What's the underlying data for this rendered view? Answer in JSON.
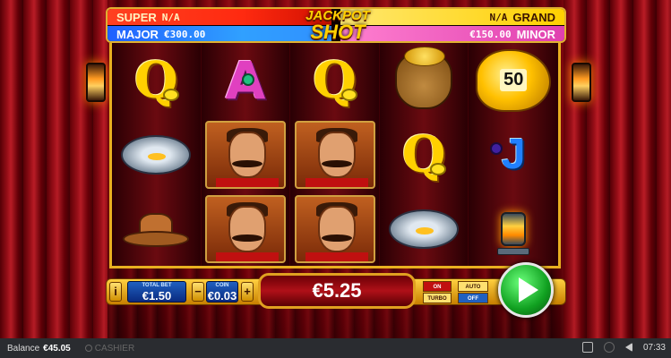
{
  "jackpots": {
    "super_label": "SUPER",
    "super_value": "N/A",
    "grand_label": "GRAND",
    "grand_value": "N/A",
    "major_label": "MAJOR",
    "major_value": "€300.00",
    "minor_label": "MINOR",
    "minor_value": "€150.00",
    "logo_line1": "JACKPOT",
    "logo_line2": "SHOT"
  },
  "reels": [
    [
      "Q-lemon",
      "plate-gold",
      "cowboy-hat"
    ],
    [
      "A-gem",
      "miner",
      "miner"
    ],
    [
      "Q-lemon",
      "miner",
      "miner"
    ],
    [
      "gold-sack",
      "Q-lemon",
      "plate-gold"
    ],
    [
      "nugget-50",
      "J-plum",
      "lantern"
    ]
  ],
  "symbols": {
    "q": "Q",
    "a": "A",
    "j": "J",
    "nugget_value": "50"
  },
  "controls": {
    "info": "i",
    "total_bet_label": "TOTAL BET",
    "total_bet_value": "€1.50",
    "coin_label": "COIN",
    "coin_value": "€0.03",
    "minus": "−",
    "plus": "+",
    "win_value": "€5.25",
    "turbo_state": "ON",
    "turbo_label": "TURBO",
    "auto_label": "AUTO",
    "auto_state": "OFF"
  },
  "footer": {
    "balance_label": "Balance",
    "balance_value": "€45.05",
    "cashier_label": "CASHIER",
    "time": "07:33"
  },
  "colors": {
    "reel_frame": "#e8b020",
    "spin_button": "#10a020",
    "win_box": "#b01018"
  }
}
